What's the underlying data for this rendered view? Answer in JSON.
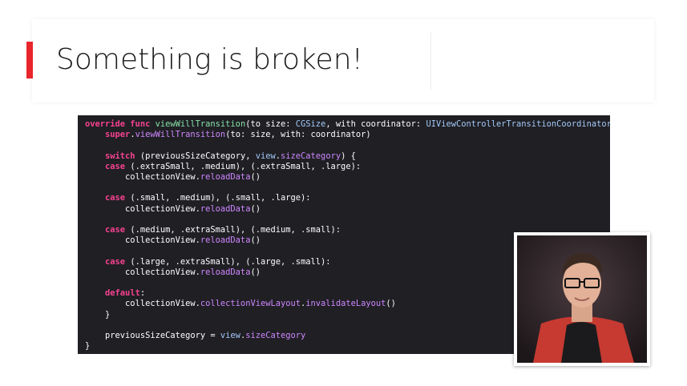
{
  "slide": {
    "title": "Something is broken!",
    "accent_color": "#e8252b"
  },
  "code_lines": [
    [
      [
        "k",
        "override func "
      ],
      [
        "s",
        "viewWillTransition"
      ],
      [
        "p",
        "(to size: "
      ],
      [
        "t",
        "CGSize"
      ],
      [
        "p",
        ", with coordinator: "
      ],
      [
        "t",
        "UIViewControllerTransitionCoordinator"
      ],
      [
        "p",
        ") {"
      ]
    ],
    [
      [
        "p",
        "    "
      ],
      [
        "k",
        "super"
      ],
      [
        "p",
        "."
      ],
      [
        "f",
        "viewWillTransition"
      ],
      [
        "p",
        "(to: size, with: coordinator)"
      ]
    ],
    [
      [
        "p",
        ""
      ]
    ],
    [
      [
        "p",
        "    "
      ],
      [
        "k",
        "switch"
      ],
      [
        "p",
        " (previousSizeCategory, "
      ],
      [
        "t",
        "view"
      ],
      [
        "p",
        "."
      ],
      [
        "f",
        "sizeCategory"
      ],
      [
        "p",
        ") {"
      ]
    ],
    [
      [
        "p",
        "    "
      ],
      [
        "k",
        "case"
      ],
      [
        "p",
        " (.extraSmall, .medium), (.extraSmall, .large):"
      ]
    ],
    [
      [
        "p",
        "        collectionView."
      ],
      [
        "f",
        "reloadData"
      ],
      [
        "p",
        "()"
      ]
    ],
    [
      [
        "p",
        ""
      ]
    ],
    [
      [
        "p",
        "    "
      ],
      [
        "k",
        "case"
      ],
      [
        "p",
        " (.small, .medium), (.small, .large):"
      ]
    ],
    [
      [
        "p",
        "        collectionView."
      ],
      [
        "f",
        "reloadData"
      ],
      [
        "p",
        "()"
      ]
    ],
    [
      [
        "p",
        ""
      ]
    ],
    [
      [
        "p",
        "    "
      ],
      [
        "k",
        "case"
      ],
      [
        "p",
        " (.medium, .extraSmall), (.medium, .small):"
      ]
    ],
    [
      [
        "p",
        "        collectionView."
      ],
      [
        "f",
        "reloadData"
      ],
      [
        "p",
        "()"
      ]
    ],
    [
      [
        "p",
        ""
      ]
    ],
    [
      [
        "p",
        "    "
      ],
      [
        "k",
        "case"
      ],
      [
        "p",
        " (.large, .extraSmall), (.large, .small):"
      ]
    ],
    [
      [
        "p",
        "        collectionView."
      ],
      [
        "f",
        "reloadData"
      ],
      [
        "p",
        "()"
      ]
    ],
    [
      [
        "p",
        ""
      ]
    ],
    [
      [
        "p",
        "    "
      ],
      [
        "k",
        "default"
      ],
      [
        "p",
        ":"
      ]
    ],
    [
      [
        "p",
        "        collectionView."
      ],
      [
        "f",
        "collectionViewLayout"
      ],
      [
        "p",
        "."
      ],
      [
        "f",
        "invalidateLayout"
      ],
      [
        "p",
        "()"
      ]
    ],
    [
      [
        "p",
        "    }"
      ]
    ],
    [
      [
        "p",
        ""
      ]
    ],
    [
      [
        "p",
        "    previousSizeCategory = "
      ],
      [
        "t",
        "view"
      ],
      [
        "p",
        "."
      ],
      [
        "f",
        "sizeCategory"
      ]
    ],
    [
      [
        "p",
        "}"
      ]
    ]
  ],
  "syntax_colors": {
    "keyword": "#f7428f",
    "type": "#a4c9f8",
    "function": "#cf87ff",
    "declaration": "#86e1a6",
    "plain": "#ffffff",
    "background": "#1f1f24"
  },
  "presenter_video": {
    "icon": "presenter-video"
  }
}
